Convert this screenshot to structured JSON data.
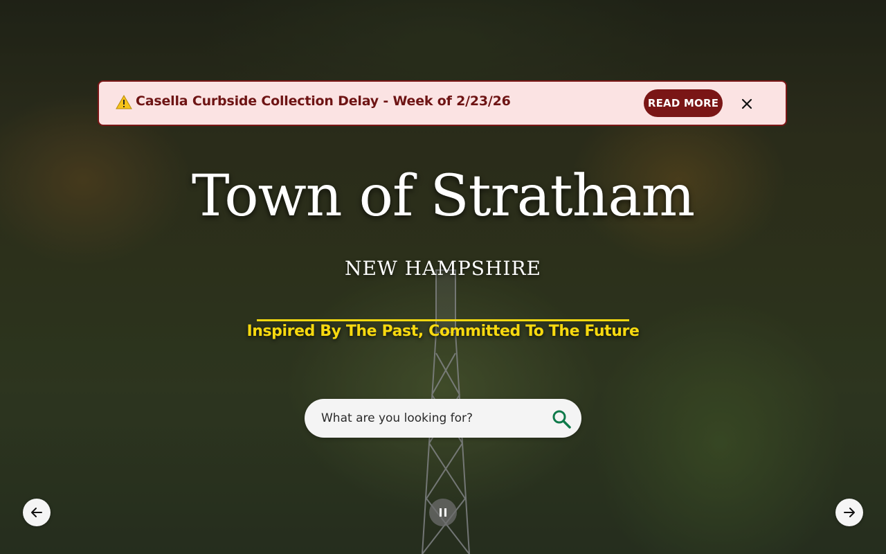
{
  "alert": {
    "icon": "warning-icon",
    "message": "Casella Curbside Collection Delay - Week of 2/23/26",
    "read_more_label": "READ MORE",
    "close_icon": "close-icon",
    "colors": {
      "background": "#fbe3e3",
      "border": "#7a1616",
      "text": "#6e1414",
      "button": "#7a1616"
    }
  },
  "hero": {
    "title": "Town of Stratham",
    "subtitle": "NEW HAMPSHIRE",
    "tagline": "Inspired By The Past, Committed To The Future",
    "accent_color": "#f3d80f"
  },
  "search": {
    "placeholder": "What are you looking for?",
    "value": "",
    "icon": "search-icon",
    "icon_color": "#0f7a4a"
  },
  "slider": {
    "prev_icon": "arrow-left-icon",
    "next_icon": "arrow-right-icon",
    "pause_icon": "pause-icon"
  }
}
